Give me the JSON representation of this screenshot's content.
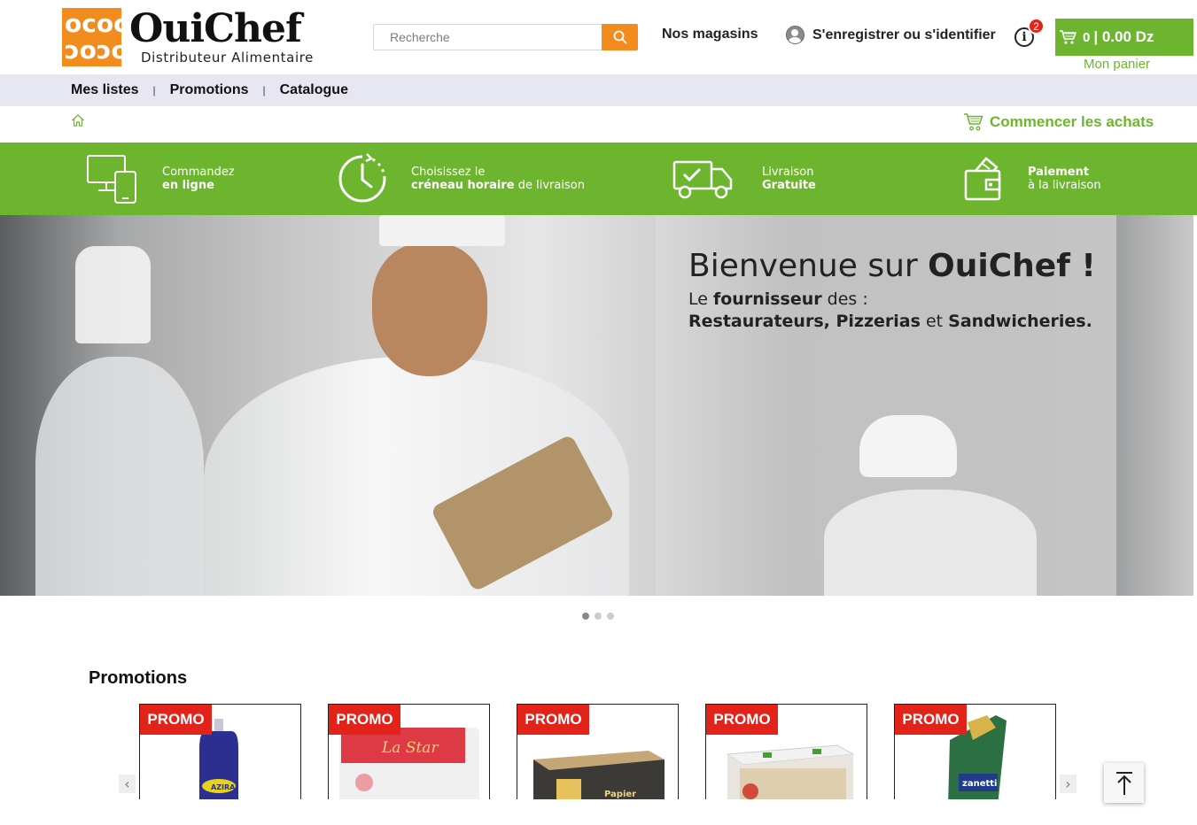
{
  "header": {
    "logo_cells": [
      "oc",
      "oc",
      "ɔo",
      "ɔo"
    ],
    "brand": "OuiChef",
    "tagline": "Distributeur Alimentaire",
    "search": {
      "placeholder": "Recherche",
      "icon": "search-icon"
    },
    "stores_label": "Nos magasins",
    "account_label": "S'enregistrer ou s'identifier",
    "info_badge": "2",
    "cart": {
      "count": "0",
      "amount": "| 0.00 Dz",
      "caption": "Mon panier"
    }
  },
  "subnav": {
    "items": [
      "Mes listes",
      "Promotions",
      "Catalogue"
    ],
    "separator": "|"
  },
  "breadcrumb": {
    "start_label": "Commencer les achats"
  },
  "features": [
    {
      "line1": "Commandez",
      "line2": "en ligne",
      "icon": "devices-icon"
    },
    {
      "line1": "Choisissez le",
      "line2_bold": "créneau horaire",
      "line2_rest": " de livraison",
      "icon": "clock-icon"
    },
    {
      "line1": "Livraison",
      "line2": "Gratuite",
      "icon": "truck-icon"
    },
    {
      "line1": "Paiement",
      "line2": "à la livraison",
      "icon": "wallet-icon"
    }
  ],
  "hero": {
    "title_pre": "Bienvenue sur ",
    "title_brand": "OuiChef !",
    "sub_pre": "Le ",
    "sub_bold": "fournisseur",
    "sub_post": " des :",
    "line2_a": "Restaurateurs, Pizzerias",
    "line2_b": " et ",
    "line2_c": "Sandwicheries.",
    "slides": 3,
    "active_slide": 1
  },
  "promotions": {
    "title": "Promotions",
    "badge": "PROMO",
    "cards": [
      {
        "name": "AZIRA",
        "color": "#2c2f8f"
      },
      {
        "name": "La Star",
        "color": "#d91a28"
      },
      {
        "name": "Papier",
        "color": "#3b3a36"
      },
      {
        "name": "",
        "color": "#d8c39a"
      },
      {
        "name": "zanetti",
        "color": "#2c6f43"
      }
    ]
  },
  "colors": {
    "brand_orange": "#f28c1e",
    "brand_green": "#6db52f",
    "promo_red": "#e2231a",
    "subnav_bg": "#e7e7f1"
  }
}
